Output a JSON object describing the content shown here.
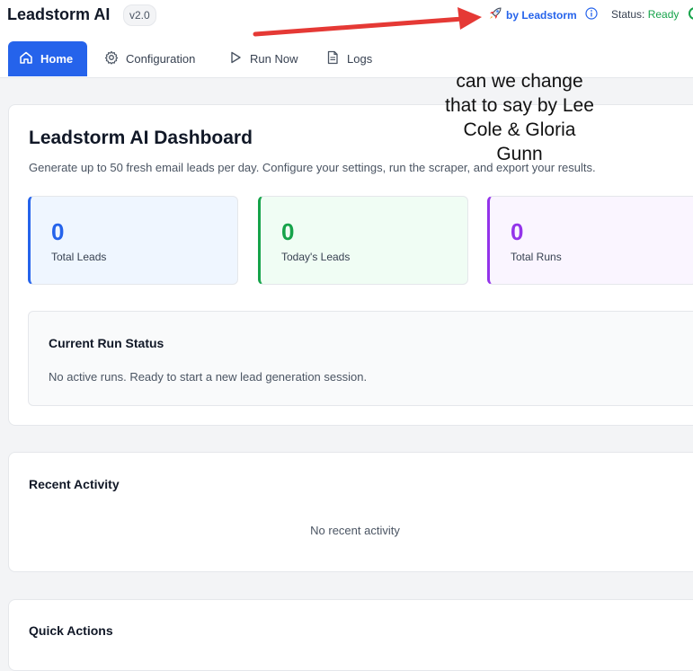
{
  "header": {
    "app_title": "Leadstorm AI",
    "version": "v2.0",
    "byline": "by Leadstorm",
    "status_label": "Status:",
    "status_value": "Ready",
    "icons": [
      "rocket-icon",
      "info-icon"
    ]
  },
  "tabs": [
    {
      "label": "Home",
      "icon": "home-icon",
      "active": true
    },
    {
      "label": "Configuration",
      "icon": "gear-icon",
      "active": false
    },
    {
      "label": "Run Now",
      "icon": "play-icon",
      "active": false
    },
    {
      "label": "Logs",
      "icon": "document-icon",
      "active": false
    }
  ],
  "dashboard": {
    "title": "Leadstorm AI Dashboard",
    "subtitle": "Generate up to 50 fresh email leads per day. Configure your settings, run the scraper, and export your results.",
    "stats": [
      {
        "value": "0",
        "label": "Total Leads",
        "color": "#2563eb"
      },
      {
        "value": "0",
        "label": "Today's Leads",
        "color": "#16a34a"
      },
      {
        "value": "0",
        "label": "Total Runs",
        "color": "#9333ea"
      }
    ],
    "run_status": {
      "title": "Current Run Status",
      "text": "No active runs. Ready to start a new lead generation session."
    }
  },
  "recent_activity": {
    "title": "Recent Activity",
    "empty_text": "No recent activity"
  },
  "quick_actions": {
    "title": "Quick Actions"
  },
  "annotation": {
    "lines": [
      "can we change",
      "that to say by Lee",
      "Cole & Gloria",
      "Gunn"
    ],
    "arrow_color": "#e53935"
  },
  "colors": {
    "accent": "#2563eb",
    "ready": "#16a34a"
  }
}
